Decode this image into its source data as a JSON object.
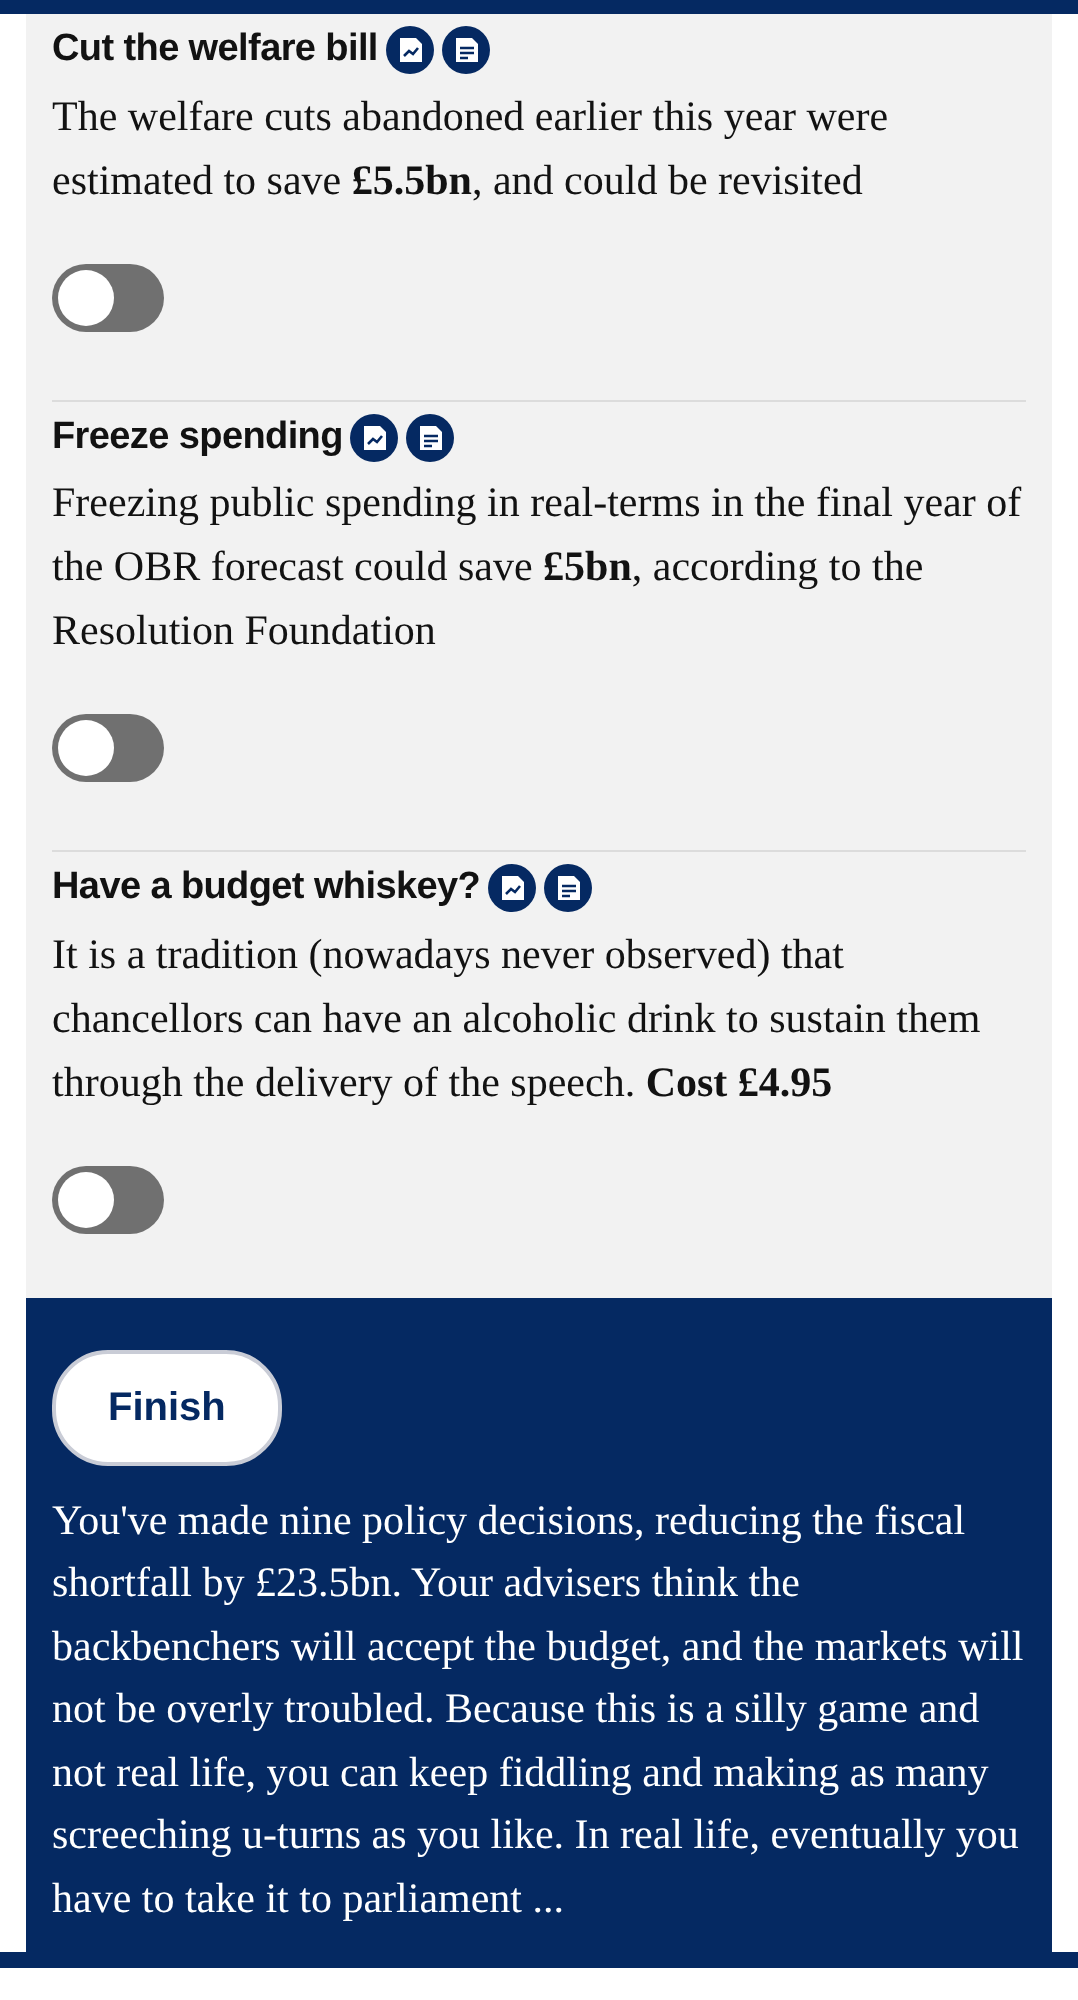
{
  "policies": [
    {
      "title": "Cut the welfare bill",
      "text": "The welfare cuts abandoned earlier this year were estimated to save **£5.5bn**, and could be revisited",
      "on": false
    },
    {
      "title": "Freeze spending",
      "text": "Freezing public spending in real-terms in the final year of the OBR forecast could save **£5bn**, according to the Resolution Foundation",
      "on": false
    },
    {
      "title": "Have a budget whiskey?",
      "text": "It is a tradition (nowadays never observed) that chancellors can have an alcoholic drink to sustain them through the delivery of the speech. **Cost £4.95**",
      "on": false
    }
  ],
  "finish": {
    "button": "Finish",
    "text": "You've made nine policy decisions, reducing the fiscal shortfall by £23.5bn. Your advisers think the backbenchers will accept the budget, and the markets will not be overly troubled. Because this is a silly game and not real life, you can keep fiddling and making as many screeching u-turns as you like. In real life, eventually you have to take it to parliament ..."
  }
}
